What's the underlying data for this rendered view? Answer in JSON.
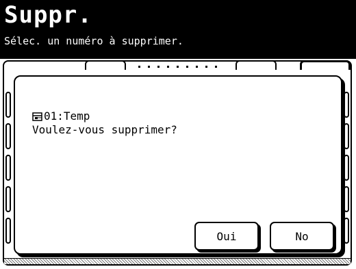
{
  "header": {
    "title": "Suppr.",
    "subtitle": "Sélec. un numéro à supprimer."
  },
  "dialog": {
    "item_icon": "mailbox-icon",
    "item_label": "01:Temp",
    "message": "Voulez-vous supprimer?",
    "yes_label": "Oui",
    "no_label": "No"
  },
  "colors": {
    "header_bg": "#000000",
    "header_text": "#ffffff",
    "panel_bg": "#ffffff"
  }
}
